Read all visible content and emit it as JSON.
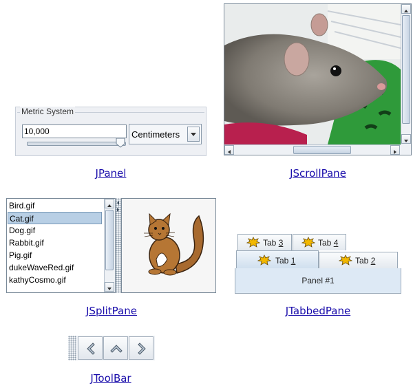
{
  "jpanel": {
    "legend": "Metric System",
    "input_value": "10,000",
    "unit_selected": "Centimeters",
    "caption": "JPanel"
  },
  "jscrollpane": {
    "caption": "JScrollPane",
    "image_subject": "mouse-photo"
  },
  "jsplitpane": {
    "files": [
      "Bird.gif",
      "Cat.gif",
      "Dog.gif",
      "Rabbit.gif",
      "Pig.gif",
      "dukeWaveRed.gif",
      "kathyCosmo.gif"
    ],
    "selected_file": "Cat.gif",
    "caption": "JSplitPane"
  },
  "jtabbedpane": {
    "tabs_back": [
      {
        "prefix": "Tab ",
        "mnemonic": "3"
      },
      {
        "prefix": "Tab ",
        "mnemonic": "4"
      }
    ],
    "tabs_front": [
      {
        "prefix": "Tab ",
        "mnemonic": "1"
      },
      {
        "prefix": "Tab ",
        "mnemonic": "2"
      }
    ],
    "panel_text": "Panel #1",
    "caption": "JTabbedPane"
  },
  "jtoolbar": {
    "buttons": [
      "back-icon",
      "up-icon",
      "forward-icon"
    ],
    "caption": "JToolBar"
  },
  "colors": {
    "link": "#1a0dab",
    "selection": "#b8cfe5",
    "tab_active": "#dde9f5"
  }
}
